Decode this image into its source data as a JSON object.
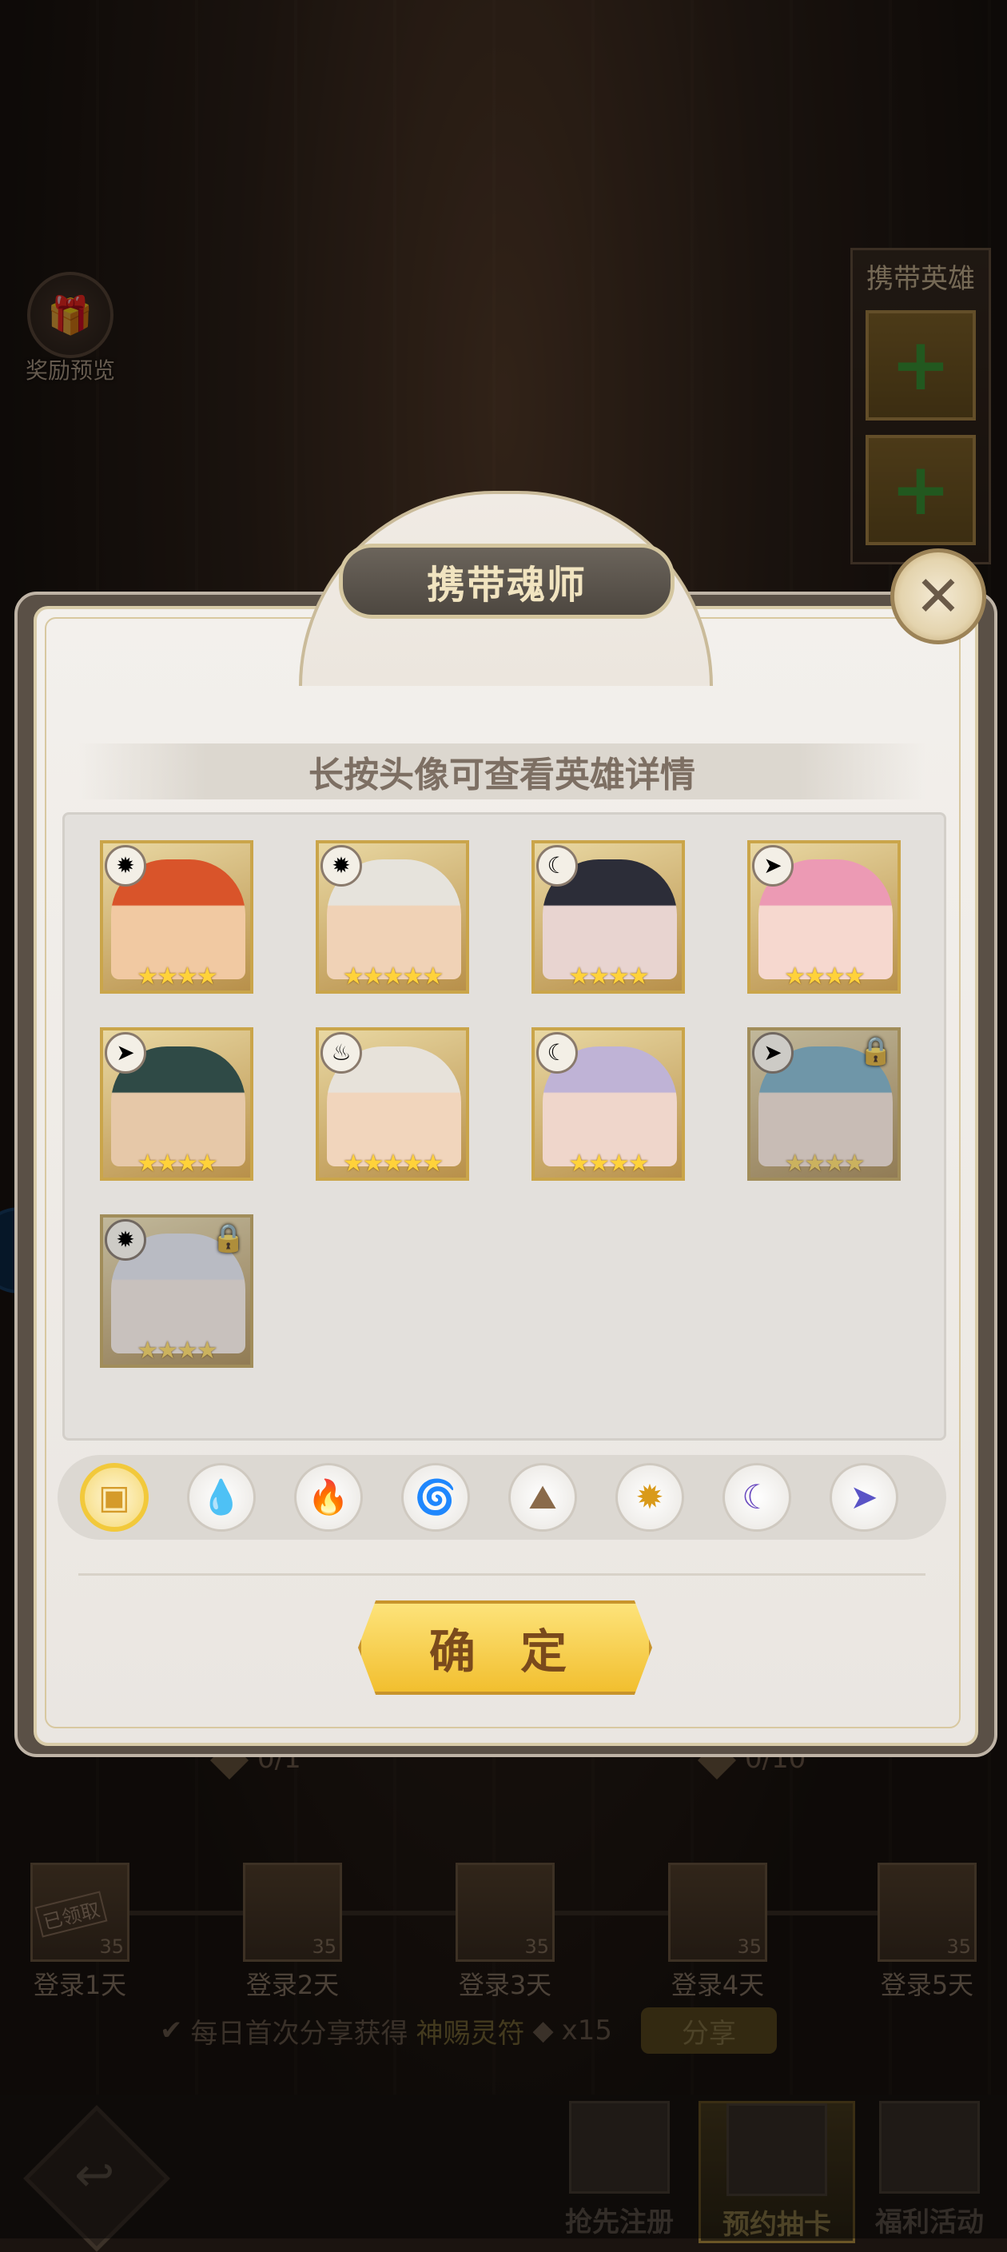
{
  "background": {
    "reward_preview_label": "奖励预览",
    "carry_hero_title": "携带英雄",
    "carry_slot_symbol": "+",
    "progress_left": "0/1",
    "progress_right": "0/10",
    "days": [
      {
        "label": "登录1天",
        "count": "35",
        "claimed": "已领取"
      },
      {
        "label": "登录2天",
        "count": "35"
      },
      {
        "label": "登录3天",
        "count": "35"
      },
      {
        "label": "登录4天",
        "count": "35"
      },
      {
        "label": "登录5天",
        "count": "35"
      }
    ],
    "share_prefix": "每日首次分享获得",
    "share_item": "神赐灵符",
    "share_qty": "x15",
    "share_button": "分享"
  },
  "bottom_nav": {
    "back_symbol": "↩",
    "tabs": [
      {
        "label": "抢先注册",
        "icon": "cards-icon"
      },
      {
        "label": "预约抽卡",
        "icon": "star-cards-icon"
      },
      {
        "label": "福利活动",
        "icon": "fortune-badge-icon"
      }
    ]
  },
  "modal": {
    "title": "携带魂师",
    "close_symbol": "✕",
    "hint": "长按头像可查看英雄详情",
    "confirm": "确 定",
    "heroes": [
      {
        "element": "light",
        "symbol": "✹",
        "stars": "★★★★",
        "locked": false,
        "hair": "#d9542a",
        "skin": "#f1c9a2"
      },
      {
        "element": "light",
        "symbol": "✹",
        "stars": "★★★★★",
        "locked": false,
        "hair": "#e6e3dc",
        "skin": "#f0d2b6"
      },
      {
        "element": "dark",
        "symbol": "☾",
        "stars": "★★★★",
        "locked": false,
        "hair": "#2c2d38",
        "skin": "#e8d4d0"
      },
      {
        "element": "void",
        "symbol": "➤",
        "stars": "★★★★",
        "locked": false,
        "hair": "#ec9ab4",
        "skin": "#f6d8cf"
      },
      {
        "element": "void",
        "symbol": "➤",
        "stars": "★★★★",
        "locked": false,
        "hair": "#2f4a46",
        "skin": "#e6c8a8"
      },
      {
        "element": "fire",
        "symbol": "♨",
        "stars": "★★★★★",
        "locked": false,
        "hair": "#e7e2da",
        "skin": "#f1d5bc"
      },
      {
        "element": "dark",
        "symbol": "☾",
        "stars": "★★★★",
        "locked": false,
        "hair": "#bfb3d6",
        "skin": "#efd6cb"
      },
      {
        "element": "void",
        "symbol": "➤",
        "stars": "★★★★",
        "locked": true,
        "hair": "#6eb5d6",
        "skin": "#f1dccf"
      },
      {
        "element": "light",
        "symbol": "✹",
        "stars": "★★★★",
        "locked": true,
        "hair": "#d8dcea",
        "skin": "#efe2dc"
      }
    ],
    "filters": [
      {
        "name": "all",
        "symbol": "▣",
        "color": "#d59b2a",
        "active": true
      },
      {
        "name": "water",
        "symbol": "💧",
        "color": "#2a7fc8",
        "active": false
      },
      {
        "name": "fire",
        "symbol": "🔥",
        "color": "#c8422a",
        "active": false
      },
      {
        "name": "wind",
        "symbol": "🌀",
        "color": "#3aa044",
        "active": false
      },
      {
        "name": "earth",
        "symbol": "⛰",
        "color": "#8a6a4a",
        "active": false
      },
      {
        "name": "light",
        "symbol": "✹",
        "color": "#d99a1a",
        "active": false
      },
      {
        "name": "dark",
        "symbol": "☾",
        "color": "#6a4ac0",
        "active": false
      },
      {
        "name": "void",
        "symbol": "➤",
        "color": "#5a54c6",
        "active": false
      }
    ]
  }
}
